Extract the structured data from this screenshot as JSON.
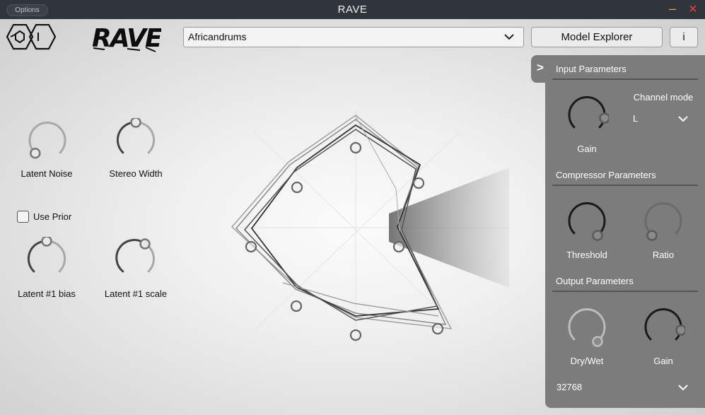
{
  "window": {
    "title": "RAVE",
    "options_label": "Options",
    "minimize_glyph": "–",
    "close_glyph": "✕"
  },
  "header": {
    "logo_text": "RAVE",
    "model": {
      "selected": "Africandrums"
    },
    "model_explorer_label": "Model Explorer",
    "info_label": "i"
  },
  "left_controls": {
    "latent_noise": {
      "label": "Latent Noise",
      "value": 0.0
    },
    "stereo_width": {
      "label": "Stereo Width",
      "value": 0.5
    },
    "use_prior": {
      "label": "Use Prior",
      "checked": false
    },
    "latent_bias": {
      "label": "Latent #1 bias",
      "value": 0.5
    },
    "latent_scale": {
      "label": "Latent #1 scale",
      "value": 0.7
    }
  },
  "side_panel": {
    "toggle_glyph": ">",
    "input": {
      "title": "Input Parameters",
      "gain_label": "Gain",
      "gain_value": 1.0,
      "channel_mode_label": "Channel mode",
      "channel_mode_value": "L"
    },
    "compressor": {
      "title": "Compressor Parameters",
      "threshold_label": "Threshold",
      "threshold_value": 0.85,
      "ratio_label": "Ratio",
      "ratio_value": 0.0
    },
    "output": {
      "title": "Output Parameters",
      "drywet_label": "Dry/Wet",
      "drywet_value": 0.85,
      "gain_label": "Gain",
      "gain_value": 1.0
    },
    "buffer_size": "32768"
  },
  "colors": {
    "titlebar": "#30353b",
    "panel": "#7c7c7c",
    "minimize": "#e8a43a",
    "close": "#e0433a"
  }
}
